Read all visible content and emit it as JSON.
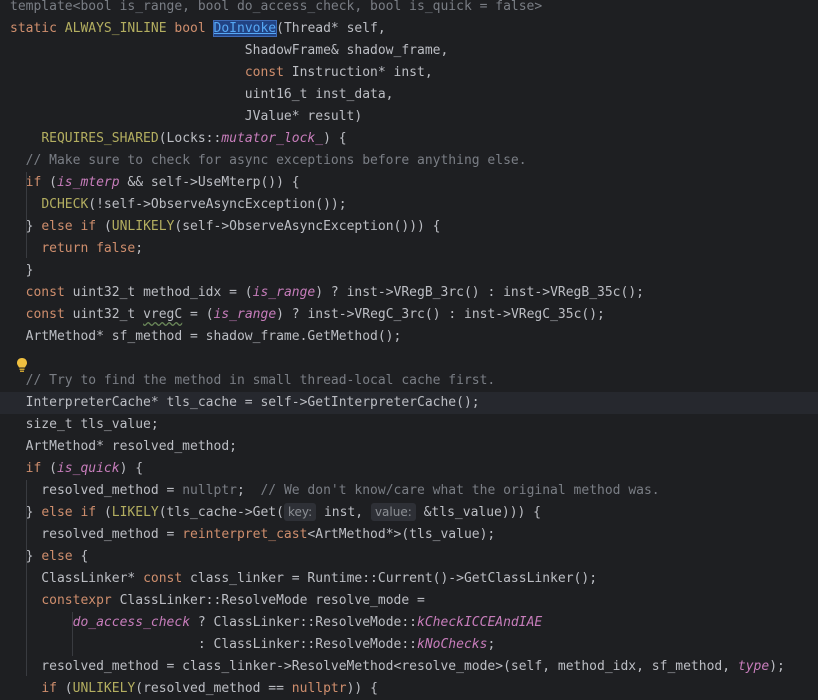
{
  "editor": {
    "lines": [
      {
        "segs": [
          [
            "template<bool is_range, bool do_access_check, bool is_quick = false>",
            "cm"
          ]
        ]
      },
      {
        "segs": [
          [
            "static ",
            "kw"
          ],
          [
            "ALWAYS_INLINE ",
            "mac"
          ],
          [
            "bool ",
            "kw"
          ],
          [
            "DoInvoke",
            "hl"
          ],
          [
            "(Thread* self,",
            ""
          ]
        ]
      },
      {
        "segs": [
          [
            "                              ShadowFrame& shadow_frame,",
            ""
          ]
        ]
      },
      {
        "segs": [
          [
            "                              ",
            ""
          ],
          [
            "const ",
            "kw"
          ],
          [
            "Instruction* inst,",
            ""
          ]
        ]
      },
      {
        "segs": [
          [
            "                              uint16_t inst_data,",
            ""
          ]
        ]
      },
      {
        "segs": [
          [
            "                              JValue* result)",
            ""
          ]
        ]
      },
      {
        "segs": [
          [
            "    ",
            ""
          ],
          [
            "REQUIRES_SHARED",
            "mac"
          ],
          [
            "(Locks::",
            ""
          ],
          [
            "mutator_lock_",
            "itv"
          ],
          [
            ") {",
            ""
          ]
        ]
      },
      {
        "segs": [
          [
            "  ",
            ""
          ],
          [
            "// Make sure to check for async exceptions before anything else.",
            "cm"
          ]
        ]
      },
      {
        "segs": [
          [
            "  ",
            ""
          ],
          [
            "if ",
            "kw"
          ],
          [
            "(",
            ""
          ],
          [
            "is_mterp",
            "itv"
          ],
          [
            " && self->UseMterp()) {",
            ""
          ]
        ]
      },
      {
        "segs": [
          [
            "    ",
            ""
          ],
          [
            "DCHECK",
            "mac"
          ],
          [
            "(!self->ObserveAsyncException());",
            ""
          ]
        ]
      },
      {
        "segs": [
          [
            "  } ",
            ""
          ],
          [
            "else if ",
            "kw"
          ],
          [
            "(",
            ""
          ],
          [
            "UNLIKELY",
            "mac"
          ],
          [
            "(self->ObserveAsyncException())) {",
            ""
          ]
        ]
      },
      {
        "segs": [
          [
            "    ",
            ""
          ],
          [
            "return false",
            "kw"
          ],
          [
            ";",
            ""
          ]
        ]
      },
      {
        "segs": [
          [
            "  }",
            ""
          ]
        ]
      },
      {
        "segs": [
          [
            "  ",
            ""
          ],
          [
            "const ",
            "kw"
          ],
          [
            "uint32_t method_idx = (",
            ""
          ],
          [
            "is_range",
            "itv"
          ],
          [
            ") ? inst->VRegB_3rc() : inst->VRegB_35c();",
            ""
          ]
        ]
      },
      {
        "segs": [
          [
            "  ",
            ""
          ],
          [
            "const ",
            "kw"
          ],
          [
            "uint32_t ",
            ""
          ],
          [
            "vregC",
            "wv"
          ],
          [
            " = (",
            ""
          ],
          [
            "is_range",
            "itv"
          ],
          [
            ") ? inst->VRegC_3rc() : inst->VRegC_35c();",
            ""
          ]
        ]
      },
      {
        "segs": [
          [
            "  ArtMethod* sf_method = shadow_frame.GetMethod();",
            ""
          ]
        ]
      },
      {
        "segs": [
          [
            "",
            ""
          ]
        ]
      },
      {
        "segs": [
          [
            "  ",
            ""
          ],
          [
            "// Try to find the method in small thread-local cache first.",
            "cm"
          ]
        ]
      },
      {
        "segs": [
          [
            "  InterpreterCache* tls_cache = self->GetInterpreterCache();",
            ""
          ]
        ],
        "current": true
      },
      {
        "segs": [
          [
            "  size_t tls_value;",
            ""
          ]
        ]
      },
      {
        "segs": [
          [
            "  ArtMethod* resolved_method;",
            ""
          ]
        ]
      },
      {
        "segs": [
          [
            "  ",
            ""
          ],
          [
            "if ",
            "kw"
          ],
          [
            "(",
            ""
          ],
          [
            "is_quick",
            "itv"
          ],
          [
            ") {",
            ""
          ]
        ]
      },
      {
        "segs": [
          [
            "    resolved_method = ",
            ""
          ],
          [
            "nullptr",
            "cm"
          ],
          [
            ";  ",
            ""
          ],
          [
            "// We don't know/care what the original method was.",
            "cm"
          ]
        ]
      },
      {
        "segs": [
          [
            "  } ",
            ""
          ],
          [
            "else if ",
            "kw"
          ],
          [
            "(",
            ""
          ],
          [
            "LIKELY",
            "mac"
          ],
          [
            "(tls_cache->Get(",
            ""
          ],
          [
            "key:",
            "hint"
          ],
          [
            " inst, ",
            ""
          ],
          [
            "value:",
            "hint"
          ],
          [
            " &tls_value))) {",
            ""
          ]
        ]
      },
      {
        "segs": [
          [
            "    resolved_method = ",
            ""
          ],
          [
            "reinterpret_cast",
            "kw"
          ],
          [
            "<ArtMethod*>(tls_value);",
            ""
          ]
        ]
      },
      {
        "segs": [
          [
            "  } ",
            ""
          ],
          [
            "else ",
            "kw"
          ],
          [
            "{",
            ""
          ]
        ]
      },
      {
        "segs": [
          [
            "    ClassLinker* ",
            ""
          ],
          [
            "const ",
            "kw"
          ],
          [
            "class_linker = Runtime::Current()->GetClassLinker();",
            ""
          ]
        ]
      },
      {
        "segs": [
          [
            "    ",
            ""
          ],
          [
            "constexpr ",
            "kw"
          ],
          [
            "ClassLinker::ResolveMode resolve_mode =",
            ""
          ]
        ]
      },
      {
        "segs": [
          [
            "        ",
            ""
          ],
          [
            "do_access_check",
            "itv"
          ],
          [
            " ? ClassLinker::ResolveMode::",
            ""
          ],
          [
            "kCheckICCEAndIAE",
            "itv"
          ]
        ]
      },
      {
        "segs": [
          [
            "                        : ClassLinker::ResolveMode::",
            ""
          ],
          [
            "kNoChecks",
            "itv"
          ],
          [
            ";",
            ""
          ]
        ]
      },
      {
        "segs": [
          [
            "    resolved_method = class_linker->ResolveMethod<resolve_mode>(self, method_idx, sf_method, ",
            ""
          ],
          [
            "type",
            "itv"
          ],
          [
            ");",
            ""
          ]
        ]
      },
      {
        "segs": [
          [
            "    ",
            ""
          ],
          [
            "if ",
            "kw"
          ],
          [
            "(",
            ""
          ],
          [
            "UNLIKELY",
            "mac"
          ],
          [
            "(resolved_method == ",
            ""
          ],
          [
            "nullptr",
            "kw"
          ],
          [
            ")) {",
            ""
          ]
        ]
      }
    ]
  },
  "icons": {
    "bulb": "lightbulb-icon"
  }
}
